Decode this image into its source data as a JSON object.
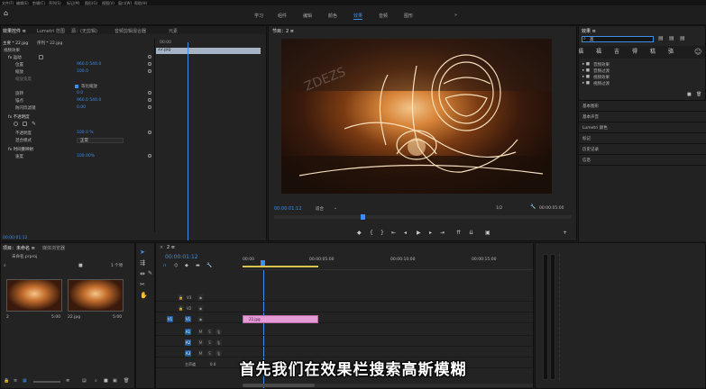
{
  "menubar": [
    "文件(F)",
    "编辑(E)",
    "剪辑(C)",
    "序列(S)",
    "标记(M)",
    "图形(G)",
    "视图(V)",
    "窗口(W)",
    "帮助(H)"
  ],
  "workspaces": [
    {
      "label": "学习",
      "active": false
    },
    {
      "label": "组件",
      "active": false
    },
    {
      "label": "编辑",
      "active": false
    },
    {
      "label": "颜色",
      "active": false
    },
    {
      "label": "效果",
      "active": true
    },
    {
      "label": "音频",
      "active": false
    },
    {
      "label": "图形",
      "active": false
    },
    {
      "label": "»",
      "active": false
    }
  ],
  "effect_controls": {
    "tabs": [
      "效果控件 ≡",
      "Lumetri 范围",
      "源：(无剪辑)",
      "音频剪辑混合器",
      "元素"
    ],
    "clip_label": "主要 * 22.jpg",
    "seq_label": "序列 * 22.jpg",
    "timecode_right": "00:00",
    "clip_chip": "22.jpg",
    "sections": [
      {
        "label": "视频效果",
        "value": ""
      },
      {
        "label": "fx  运动",
        "value": ""
      },
      {
        "label": "位置",
        "value": "960.0   540.0"
      },
      {
        "label": "缩放",
        "value": "100.0"
      },
      {
        "label": "缩放宽度",
        "value": "100.0"
      },
      {
        "label": "",
        "value": "等比缩放"
      },
      {
        "label": "旋转",
        "value": "0.0"
      },
      {
        "label": "锚点",
        "value": "960.0   540.0"
      },
      {
        "label": "防闪烁滤镜",
        "value": "0.00"
      },
      {
        "label": "fx  不透明度",
        "value": ""
      },
      {
        "label": "",
        "value": ""
      },
      {
        "label": "不透明度",
        "value": "100.0 %"
      },
      {
        "label": "混合模式",
        "value": "正常"
      },
      {
        "label": "fx  时间重映射",
        "value": ""
      },
      {
        "label": "速度",
        "value": "100.00%"
      }
    ],
    "bottom_timecode": "00:00:01:12"
  },
  "program": {
    "tab": "节目：2 ≡",
    "timecode": "00:00:01:12",
    "fit": "适合",
    "ratio": "1/2",
    "duration": "00:00:05:00",
    "wrench": "🔧"
  },
  "effects": {
    "title": "效果 ≡",
    "search_value": "高",
    "fx_buttons": [
      "高",
      "福",
      "福",
      "吉",
      "得",
      "糕",
      "骆"
    ],
    "tree": [
      {
        "label": "音频效果"
      },
      {
        "label": "音频过渡"
      },
      {
        "label": "视频效果"
      },
      {
        "label": "视频过渡"
      }
    ],
    "panels": [
      "基本图形",
      "基本声音",
      "Lumetri 颜色",
      "标记",
      "历史记录",
      "信息"
    ]
  },
  "project": {
    "tabs": [
      "项目：未命名 ≡",
      "媒体浏览器"
    ],
    "file": "未命名.prproj",
    "count": "1 个项",
    "items": [
      {
        "name": "2",
        "duration": "5:00"
      },
      {
        "name": "22.jpg",
        "duration": "5:00"
      }
    ]
  },
  "timeline": {
    "tab": "2 ≡",
    "timecode": "00:00:01:12",
    "ruler": [
      "00:00",
      "00:00:05:00",
      "00:00:10:00",
      "00:00:15:00"
    ],
    "clip": "22.jpg",
    "tracks": [
      "V3",
      "V2",
      "V1",
      "A1",
      "A2",
      "A3"
    ],
    "master": "主声道",
    "master_value": "0.0"
  },
  "subtitle": "首先我们在效果栏搜索高斯模糊"
}
